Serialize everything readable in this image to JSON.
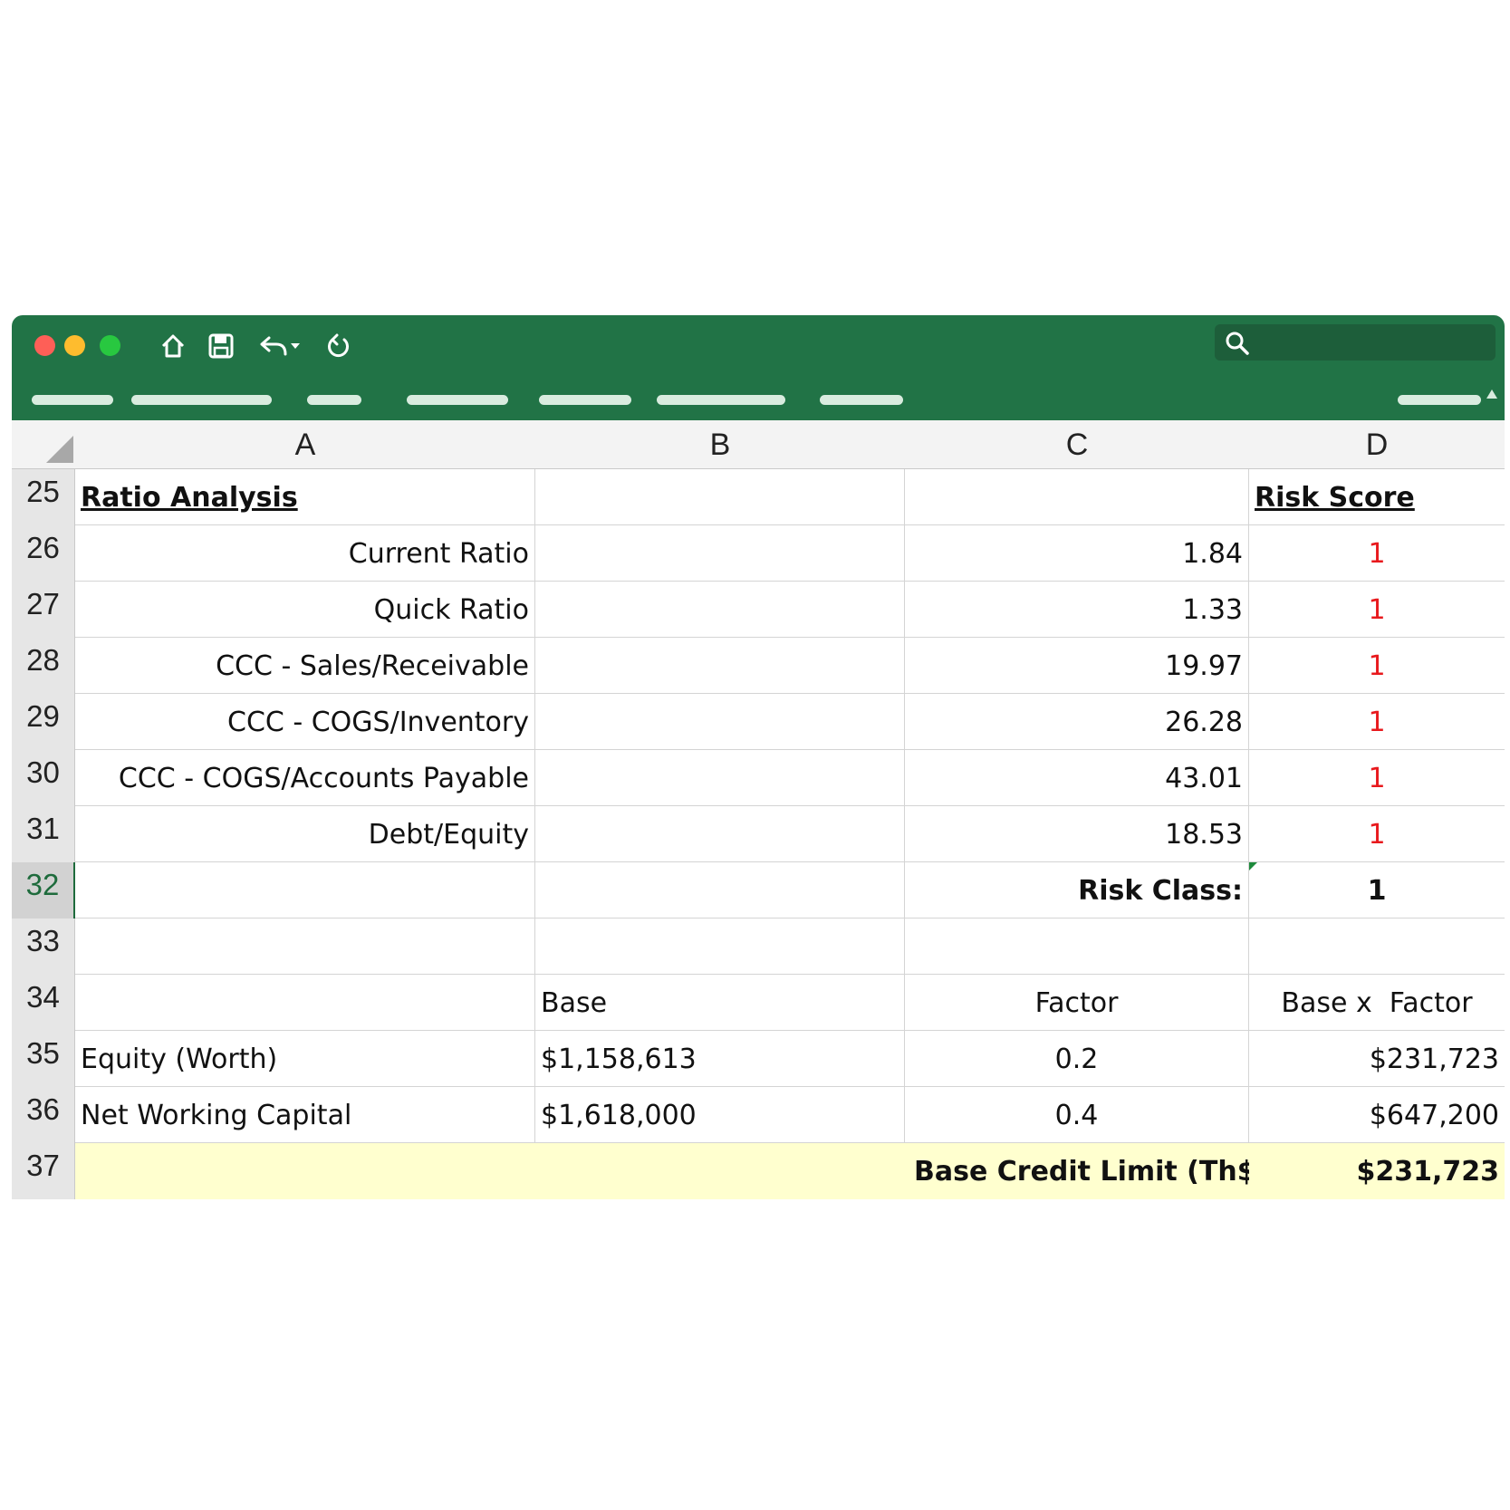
{
  "toolbar": {
    "icons": [
      "home-icon",
      "save-icon",
      "undo-icon",
      "redo-icon"
    ],
    "search_placeholder": ""
  },
  "colors": {
    "titlebar": "#217346",
    "highlight": "#ffffcf",
    "risk_red": "#e8191d"
  },
  "columns": [
    "A",
    "B",
    "C",
    "D"
  ],
  "rows": [
    {
      "num": "25",
      "a": "Ratio Analysis",
      "b": "",
      "c": "",
      "d": "Risk Score"
    },
    {
      "num": "26",
      "a": "Current Ratio",
      "b": "",
      "c": "1.84",
      "d": "1"
    },
    {
      "num": "27",
      "a": "Quick Ratio",
      "b": "",
      "c": "1.33",
      "d": "1"
    },
    {
      "num": "28",
      "a": "CCC - Sales/Receivable",
      "b": "",
      "c": "19.97",
      "d": "1"
    },
    {
      "num": "29",
      "a": "CCC - COGS/Inventory",
      "b": "",
      "c": "26.28",
      "d": "1"
    },
    {
      "num": "30",
      "a": "CCC - COGS/Accounts Payable",
      "b": "",
      "c": "43.01",
      "d": "1"
    },
    {
      "num": "31",
      "a": "Debt/Equity",
      "b": "",
      "c": "18.53",
      "d": "1"
    },
    {
      "num": "32",
      "a": "",
      "b": "",
      "c": "Risk Class:",
      "d": "1"
    },
    {
      "num": "33",
      "a": "",
      "b": "",
      "c": "",
      "d": ""
    },
    {
      "num": "34",
      "a": "",
      "b": "Base",
      "c": "Factor",
      "d": "Base x  Factor"
    },
    {
      "num": "35",
      "a": "Equity (Worth)",
      "b": "$1,158,613",
      "c": "0.2",
      "d": "$231,723"
    },
    {
      "num": "36",
      "a": "Net Working Capital",
      "b": "$1,618,000",
      "c": "0.4",
      "d": "$647,200"
    },
    {
      "num": "37",
      "a": "",
      "b": "",
      "c": "Base Credit Limit (Th$)=",
      "d": "$231,723"
    }
  ]
}
